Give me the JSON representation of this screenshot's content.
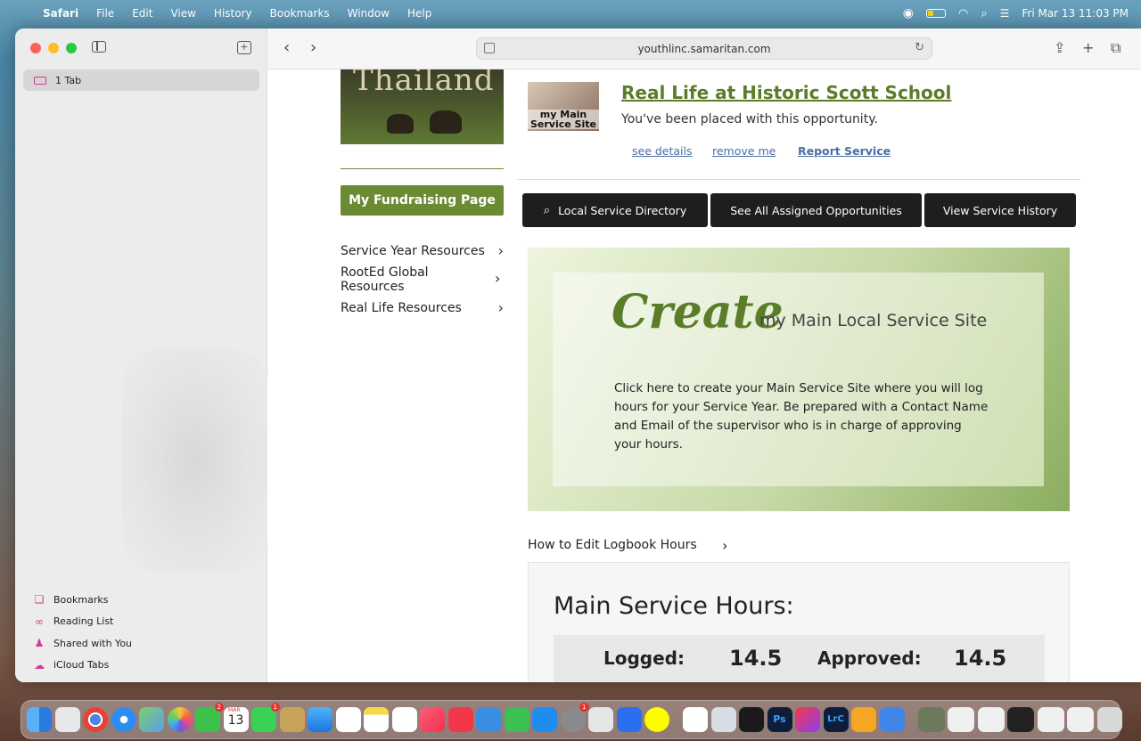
{
  "menubar": {
    "app": "Safari",
    "items": [
      "File",
      "Edit",
      "View",
      "History",
      "Bookmarks",
      "Window",
      "Help"
    ],
    "datetime": "Fri Mar 13  11:03 PM"
  },
  "sidebar": {
    "tab_label": "1 Tab",
    "bottom_items": [
      {
        "label": "Bookmarks",
        "icon": "bookmark-icon"
      },
      {
        "label": "Reading List",
        "icon": "glasses-icon"
      },
      {
        "label": "Shared with You",
        "icon": "people-icon"
      },
      {
        "label": "iCloud Tabs",
        "icon": "cloud-icon"
      }
    ]
  },
  "toolbar": {
    "url": "youthlinc.samaritan.com"
  },
  "page": {
    "hero_text": "Thailand",
    "fundraising_button": "My Fundraising Page",
    "left_nav": [
      {
        "label": "Service Year Resources"
      },
      {
        "label": "RootEd Global Resources"
      },
      {
        "label": "Real Life Resources"
      }
    ],
    "opportunity": {
      "thumb_caption_line1": "my Main",
      "thumb_caption_line2": "Service Site",
      "title": "Real Life at Historic Scott School",
      "subtitle": "You've been placed with this opportunity.",
      "links": [
        "see details",
        "remove me",
        "Report Service"
      ]
    },
    "buttons": {
      "local_directory": "Local Service Directory",
      "assigned": "See All Assigned Opportunities",
      "history": "View Service History"
    },
    "create_card": {
      "headline": "Create",
      "tagline": "my Main Local Service Site",
      "description": "Click here to create your Main Service Site where you will log hours for your Service Year. Be prepared with a Contact Name and Email of the supervisor who is in charge of approving your hours."
    },
    "howto_link": "How to Edit Logbook Hours",
    "hours": {
      "title": "Main Service Hours:",
      "logged_label": "Logged:",
      "logged_value": "14.5",
      "approved_label": "Approved:",
      "approved_value": "14.5"
    }
  },
  "dock": {
    "badges": {
      "facetime": "2",
      "calendar_day": "13",
      "calendar_month": "MAR",
      "messages": "1",
      "settings": "1"
    }
  },
  "colors": {
    "accent_green": "#6a8a33",
    "title_green": "#5b7d2a",
    "link_blue": "#4a6fa5",
    "dark_button": "#1e1e1e"
  }
}
